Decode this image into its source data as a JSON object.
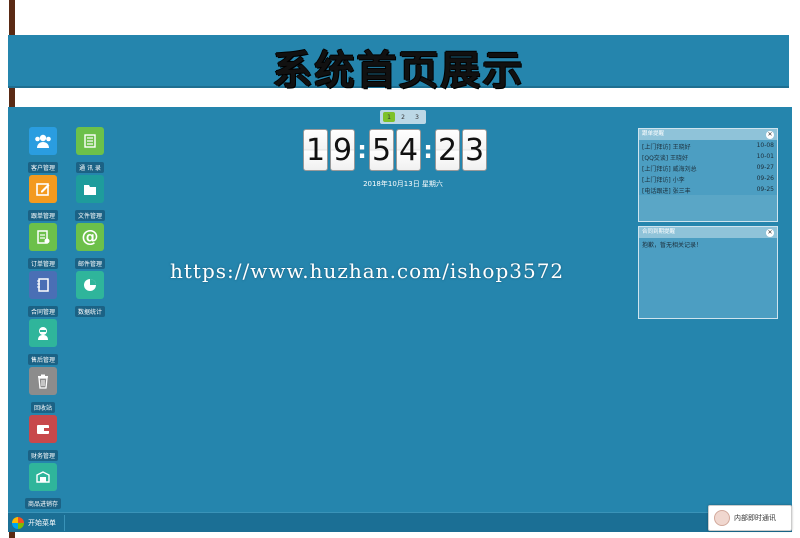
{
  "banner": {
    "title": "系统首页展示"
  },
  "desktop": {
    "icons_left": [
      {
        "label": "客户管理",
        "icon": "customers-icon",
        "color": "#2a9de0"
      },
      {
        "label": "跟单管理",
        "icon": "edit-icon",
        "color": "#f39a1f"
      },
      {
        "label": "订单管理",
        "icon": "order-icon",
        "color": "#6cc04a"
      },
      {
        "label": "合同管理",
        "icon": "contract-icon",
        "color": "#4a6fb5"
      },
      {
        "label": "售后管理",
        "icon": "support-icon",
        "color": "#2fb59b"
      },
      {
        "label": "回收站",
        "icon": "trash-icon",
        "color": "#8c8c8c"
      },
      {
        "label": "财务管理",
        "icon": "wallet-icon",
        "color": "#c8484b"
      },
      {
        "label": "商品进销存",
        "icon": "inventory-icon",
        "color": "#2fb59b"
      }
    ],
    "icons_right": [
      {
        "label": "通 讯 录",
        "icon": "contacts-icon",
        "color": "#6cc04a"
      },
      {
        "label": "文件管理",
        "icon": "folder-icon",
        "color": "#1e9c9c"
      },
      {
        "label": "邮件管理",
        "icon": "email-icon",
        "color": "#6cc04a"
      },
      {
        "label": "数据统计",
        "icon": "pie-chart-icon",
        "color": "#2fb59b"
      }
    ],
    "pager": [
      "1",
      "2",
      "3"
    ],
    "clock": {
      "h1": "1",
      "h2": "9",
      "m1": "5",
      "m2": "4",
      "s1": "2",
      "s2": "3",
      "sep": ":"
    },
    "date": "2018年10月13日 星期六",
    "watermark": "https://www.huzhan.com/ishop3572"
  },
  "panels": {
    "followup": {
      "title": "跟单提醒",
      "close": "✕",
      "rows": [
        {
          "text": "[上门拜访] 王晓好",
          "date": "10-08"
        },
        {
          "text": "[QQ交谈] 王晓好",
          "date": "10-01"
        },
        {
          "text": "[上门拜访] 威海刘总",
          "date": "09-27"
        },
        {
          "text": "[上门拜访] 小李",
          "date": "09-26"
        },
        {
          "text": "[电话跟进] 张三丰",
          "date": "09-25"
        }
      ]
    },
    "contract": {
      "title": "合同到期提醒",
      "close": "✕",
      "empty": "抱歉，暂无相关记录！"
    }
  },
  "taskbar": {
    "start_label": "开始菜单",
    "im_label": "内部即时通讯"
  }
}
